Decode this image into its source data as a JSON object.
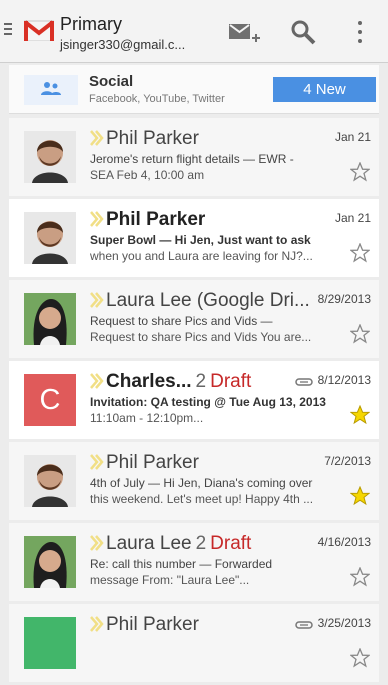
{
  "header": {
    "title": "Primary",
    "account": "jsinger330@gmail.c..."
  },
  "social": {
    "title": "Social",
    "subtitle": "Facebook, YouTube, Twitter",
    "new_badge": "4 New"
  },
  "emails": [
    {
      "sender": "Phil Parker",
      "count": "",
      "draft": "",
      "date": "Jan 21",
      "line1": "Jerome's return flight details — EWR -",
      "line2": "SEA Feb 4, 10:00 am",
      "unread": false,
      "starred": false,
      "avatar": "man",
      "attachment": false
    },
    {
      "sender": "Phil Parker",
      "count": "",
      "draft": "",
      "date": "Jan 21",
      "line1": "Super Bowl — Hi Jen, Just want to ask",
      "line2": "when you and Laura are leaving for NJ?...",
      "unread": true,
      "starred": false,
      "avatar": "man",
      "attachment": false
    },
    {
      "sender": "Laura Lee (Google Dri...",
      "count": "",
      "draft": "",
      "date": "8/29/2013",
      "line1": "Request to share Pics and Vids —",
      "line2": "Request to share Pics and Vids You are...",
      "unread": false,
      "starred": false,
      "avatar": "woman",
      "attachment": false
    },
    {
      "sender": "Charles...",
      "count": "2",
      "draft": "Draft",
      "date": "8/12/2013",
      "line1": "Invitation: QA testing @ Tue Aug 13, 2013",
      "line2": "11:10am - 12:10pm...",
      "unread": true,
      "starred": true,
      "avatar": "C",
      "attachment": true
    },
    {
      "sender": "Phil Parker",
      "count": "",
      "draft": "",
      "date": "7/2/2013",
      "line1": "4th of July — Hi Jen, Diana's coming over",
      "line2": "this weekend. Let's meet up! Happy 4th ...",
      "unread": false,
      "starred": true,
      "avatar": "man",
      "attachment": false
    },
    {
      "sender": "Laura Lee",
      "count": "2",
      "draft": "Draft",
      "date": "4/16/2013",
      "line1": "Re: call this number — Forwarded",
      "line2": "message From: \"Laura Lee\"...",
      "unread": false,
      "starred": false,
      "avatar": "woman",
      "attachment": false
    },
    {
      "sender": "Phil Parker",
      "count": "",
      "draft": "",
      "date": "3/25/2013",
      "line1": "",
      "line2": "",
      "unread": false,
      "starred": false,
      "avatar": "green",
      "attachment": true
    }
  ],
  "icons": {
    "menu": "menu-icon",
    "logo": "gmail-logo",
    "compose": "compose-mail-icon",
    "search": "search-icon",
    "overflow": "overflow-menu-icon",
    "social": "people-icon",
    "star": "star-icon",
    "importance": "importance-marker-icon"
  },
  "colors": {
    "accent": "#4a90e2",
    "draft": "#c62828",
    "star": "#f5d600",
    "c_avatar": "#e05a5a",
    "green_avatar": "#42b66a"
  }
}
